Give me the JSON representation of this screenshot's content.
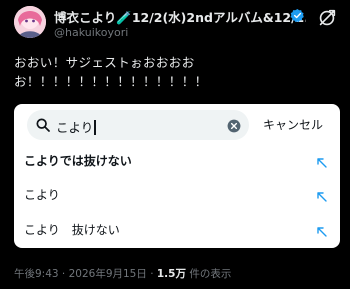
{
  "author": {
    "display_name": "博衣こより🧪12/2(水)2ndアルバム&12/2...",
    "handle": "@hakuikoyori"
  },
  "tweet": {
    "line1": "おおい！サジェストぉおおおお",
    "line2": "お！！！！！！！！！！！！！！"
  },
  "search": {
    "query": "こより",
    "cancel_label": "キャンセル"
  },
  "suggestions": [
    {
      "label": "こよりでは抜けない",
      "bold": true
    },
    {
      "label": "こより",
      "bold": false
    },
    {
      "label": "こより　抜けない",
      "bold": false
    }
  ],
  "meta": {
    "time": "午後9:43 · 2026年9月15日 · ",
    "views_count": "1.5万",
    "views_label": " 件の表示"
  },
  "colors": {
    "background": "#000000",
    "verified_badge": "#1d9bf0",
    "suggestion_arrow": "#1d9bf0",
    "panel_bg": "#ffffff"
  },
  "icons": [
    "avatar",
    "verified-badge-icon",
    "more-options-icon",
    "search-icon",
    "clear-icon",
    "suggestion-arrow-icon"
  ]
}
